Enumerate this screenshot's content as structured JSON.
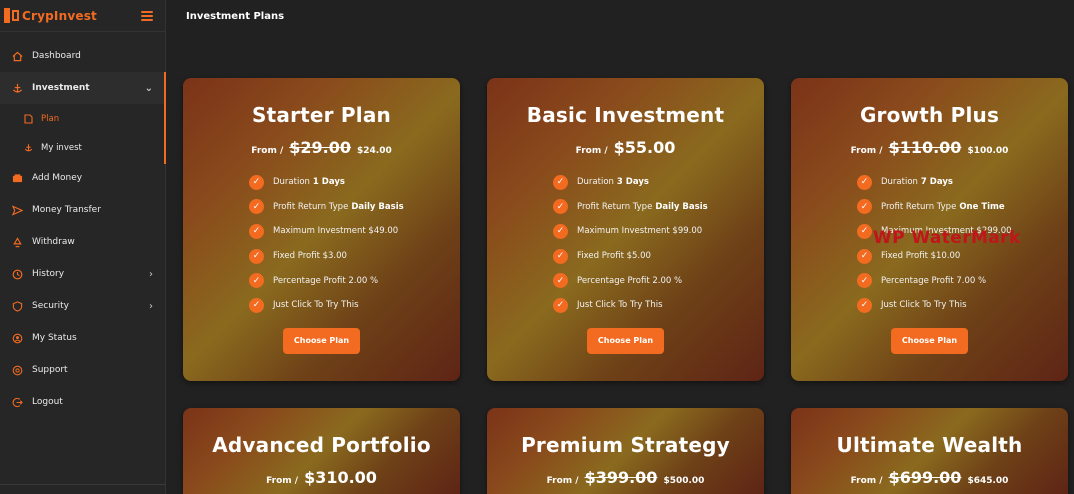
{
  "brand": {
    "name": "CrypInvest"
  },
  "page": {
    "title": "Investment Plans"
  },
  "sidebar": {
    "items": [
      {
        "label": "Dashboard",
        "icon": "home-icon"
      },
      {
        "label": "Investment",
        "icon": "anchor-icon"
      },
      {
        "label": "Add Money",
        "icon": "wallet-icon"
      },
      {
        "label": "Money Transfer",
        "icon": "send-icon"
      },
      {
        "label": "Withdraw",
        "icon": "recycle-icon"
      },
      {
        "label": "History",
        "icon": "clock-icon"
      },
      {
        "label": "Security",
        "icon": "shield-icon"
      },
      {
        "label": "My Status",
        "icon": "user-circle-icon"
      },
      {
        "label": "Support",
        "icon": "help-icon"
      },
      {
        "label": "Logout",
        "icon": "logout-icon"
      }
    ],
    "investment_sub": [
      {
        "label": "Plan",
        "icon": "file-icon"
      },
      {
        "label": "My invest",
        "icon": "anchor-icon"
      }
    ]
  },
  "cards": [
    {
      "title": "Starter Plan",
      "from": "From /",
      "old_price": "$29.00",
      "new_price": "$24.00",
      "features": {
        "duration_label": "Duration",
        "duration_value": "1 Days",
        "return_label": "Profit Return Type",
        "return_value": "Daily Basis",
        "max": "Maximum Investment $49.00",
        "fixed": "Fixed Profit $3.00",
        "percentage": "Percentage Profit 2.00 %",
        "try": "Just Click To Try This"
      },
      "button": "Choose Plan"
    },
    {
      "title": "Basic Investment",
      "from": "From /",
      "price": "$55.00",
      "features": {
        "duration_label": "Duration",
        "duration_value": "3 Days",
        "return_label": "Profit Return Type",
        "return_value": "Daily Basis",
        "max": "Maximum Investment $99.00",
        "fixed": "Fixed Profit $5.00",
        "percentage": "Percentage Profit 2.00 %",
        "try": "Just Click To Try This"
      },
      "button": "Choose Plan"
    },
    {
      "title": "Growth Plus",
      "from": "From /",
      "old_price": "$110.00",
      "new_price": "$100.00",
      "features": {
        "duration_label": "Duration",
        "duration_value": "7 Days",
        "return_label": "Profit Return Type",
        "return_value": "One Time",
        "max": "Maximum Investment $299.00",
        "fixed": "Fixed Profit $10.00",
        "percentage": "Percentage Profit 7.00 %",
        "try": "Just Click To Try This"
      },
      "button": "Choose Plan"
    },
    {
      "title": "Advanced Portfolio",
      "from": "From /",
      "price": "$310.00"
    },
    {
      "title": "Premium Strategy",
      "from": "From /",
      "old_price": "$399.00",
      "new_price": "$500.00"
    },
    {
      "title": "Ultimate Wealth",
      "from": "From /",
      "old_price": "$699.00",
      "new_price": "$645.00"
    }
  ],
  "watermark": "WP WaterMark",
  "colors": {
    "accent": "#f26b21",
    "background": "#212121",
    "sidebar": "#262626",
    "watermark": "#c0151a"
  }
}
